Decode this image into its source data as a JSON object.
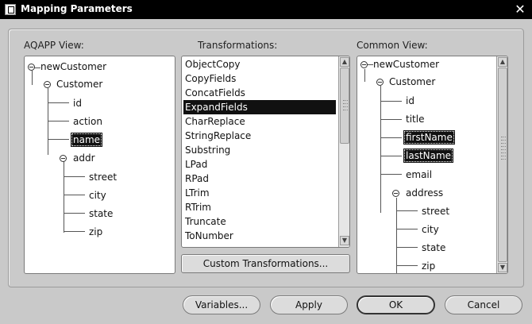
{
  "window": {
    "title": "Mapping Parameters",
    "close_glyph": "✕"
  },
  "aqapp": {
    "label": "AQAPP View:",
    "tree": {
      "root": "newCustomer",
      "customer": "Customer",
      "id": "id",
      "action": "action",
      "name": "name",
      "addr": "addr",
      "street": "street",
      "city": "city",
      "state": "state",
      "zip": "zip"
    },
    "selected": "name"
  },
  "transformations": {
    "label": "Transformations:",
    "items": [
      "ObjectCopy",
      "CopyFields",
      "ConcatFields",
      "ExpandFields",
      "CharReplace",
      "StringReplace",
      "Substring",
      "LPad",
      "RPad",
      "LTrim",
      "RTrim",
      "Truncate",
      "ToNumber"
    ],
    "selected": "ExpandFields",
    "custom_button": "Custom Transformations..."
  },
  "common": {
    "label": "Common View:",
    "tree": {
      "root": "newCustomer",
      "customer": "Customer",
      "id": "id",
      "title": "title",
      "firstName": "firstName",
      "lastName": "lastName",
      "email": "email",
      "address": "address",
      "street": "street",
      "city": "city",
      "state": "state",
      "zip": "zip"
    },
    "selected": [
      "firstName",
      "lastName"
    ]
  },
  "buttons": {
    "variables": "Variables...",
    "apply": "Apply",
    "ok": "OK",
    "cancel": "Cancel"
  },
  "icons": {
    "collapse": "collapse-node-icon",
    "window": "window-icon",
    "close": "close-icon"
  }
}
